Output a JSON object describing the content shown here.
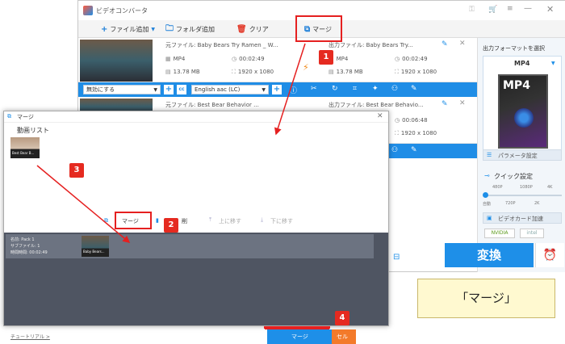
{
  "app": {
    "title": "ビデオコンバータ"
  },
  "toolbar": {
    "add_file": "ファイル追加",
    "add_folder": "フォルダ追加",
    "clear": "クリア",
    "merge": "マージ"
  },
  "file1": {
    "source": "元ファイル: Baby Bears Try Ramen _ W...",
    "output": "出力ファイル: Baby Bears Try...",
    "src_format": "MP4",
    "src_duration": "00:02:49",
    "src_size": "13.78 MB",
    "src_res": "1920 x 1080",
    "out_format": "MP4",
    "out_duration": "00:02:49",
    "out_size": "13.78 MB",
    "out_res": "1920 x 1080"
  },
  "bluebar": {
    "subtitle": "無効にする",
    "audio": "English aac (LC)"
  },
  "file2": {
    "source": "元ファイル: Best Bear Behavior ...",
    "output": "出力ファイル: Best Bear Behavio...",
    "out_duration": "00:06:48",
    "out_res": "1920 x 1080"
  },
  "right_panel": {
    "output_format_label": "出力フォーマットを選択",
    "format": "MP4",
    "param_settings": "パラメータ設定",
    "quick_settings": "クイック設定",
    "quality_marks_top": [
      "480P",
      "1080P",
      "4K"
    ],
    "quality_marks_bottom": [
      "自動",
      "720P",
      "2K"
    ],
    "gpu_accel": "ビデオカード加速",
    "gpu_vendors": [
      "NVIDIA",
      "intel"
    ],
    "convert": "変換"
  },
  "dialog": {
    "title": "マージ",
    "list_label": "動画リスト",
    "item_thumb_caption": "Best Bear B...",
    "merge_btn": "マージ",
    "delete_btn": "削",
    "up_btn": "上に移す",
    "down_btn": "下に移す",
    "pack_name": "名前: Pack 1",
    "pack_subfiles": "サブファイル: 1",
    "pack_time": "時間時間: 00:02:49",
    "pack_thumb_caption": "Baby Bears...",
    "tutorial": "チュートリアル >",
    "footer_merge": "マージ",
    "footer_cancel": "セル"
  },
  "steps": [
    "1",
    "2",
    "3",
    "4"
  ],
  "caption": "「マージ」",
  "colors": {
    "accent": "#1e8fe8",
    "highlight_red": "#e52020",
    "caption_bg": "#fff9d0"
  }
}
